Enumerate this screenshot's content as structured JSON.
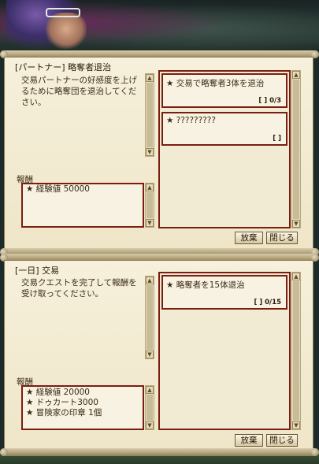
{
  "quests": [
    {
      "title": "[パートナー] 略奪者退治",
      "description": "交易パートナーの好感度を上げるために略奪団を退治してください。",
      "reward_label": "報酬",
      "rewards": [
        "★ 経験値 50000"
      ],
      "objectives": [
        {
          "text": "★ 交易で略奪者3体を退治",
          "count": "[   ] 0/3"
        },
        {
          "text": "★ ?????????",
          "count": "[   ]"
        }
      ],
      "buttons": {
        "abandon": "放棄",
        "close": "閉じる"
      }
    },
    {
      "title": "[一日] 交易",
      "description": "交易クエストを完了して報酬を受け取ってください。",
      "reward_label": "報酬",
      "rewards": [
        "★ 経験値 20000",
        "★ ドゥカート3000",
        "★ 冒険家の印章 1個"
      ],
      "objectives": [
        {
          "text": "★ 略奪者を15体退治",
          "count": "[   ] 0/15"
        }
      ],
      "buttons": {
        "abandon": "放棄",
        "close": "閉じる"
      }
    }
  ]
}
